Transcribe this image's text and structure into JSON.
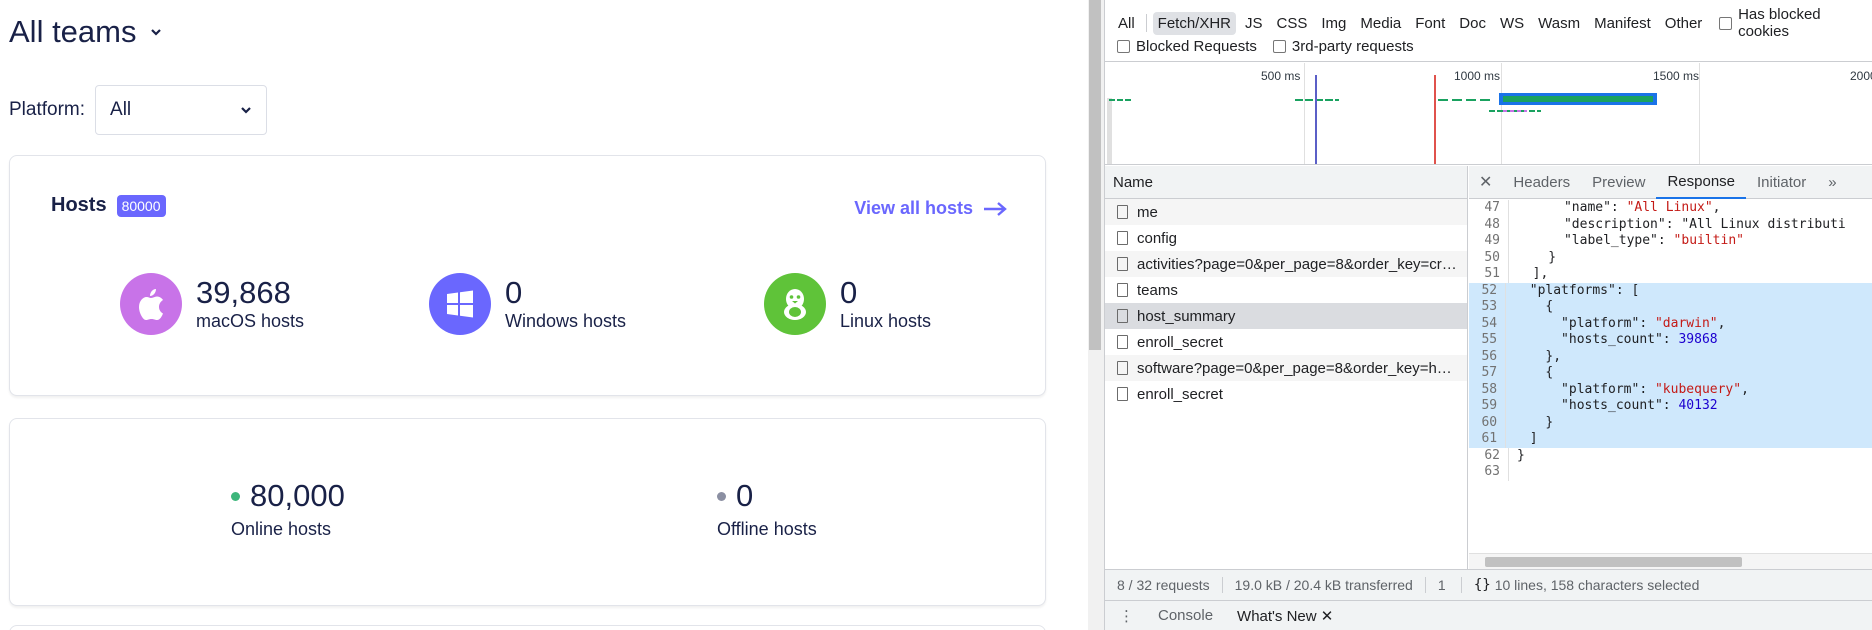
{
  "app": {
    "team_title": "All teams",
    "platform_label": "Platform:",
    "platform_value": "All",
    "hosts_card": {
      "title": "Hosts",
      "badge": "80000",
      "view_all": "View all hosts",
      "platforms": [
        {
          "count": "39,868",
          "label": "macOS hosts",
          "icon": "apple-icon",
          "color": "#c873e8"
        },
        {
          "count": "0",
          "label": "Windows hosts",
          "icon": "windows-icon",
          "color": "#6a67fe"
        },
        {
          "count": "0",
          "label": "Linux hosts",
          "icon": "linux-icon",
          "color": "#5fc339"
        }
      ]
    },
    "status_card": {
      "online_count": "80,000",
      "online_label": "Online hosts",
      "offline_count": "0",
      "offline_label": "Offline hosts",
      "online_color": "#3db67b",
      "offline_color": "#8b8fa2"
    }
  },
  "devtools": {
    "filter_types": [
      "All",
      "Fetch/XHR",
      "JS",
      "CSS",
      "Img",
      "Media",
      "Font",
      "Doc",
      "WS",
      "Wasm",
      "Manifest",
      "Other"
    ],
    "active_filter": "Fetch/XHR",
    "has_blocked_cookies": "Has blocked cookies",
    "blocked_requests": "Blocked Requests",
    "third_party": "3rd-party requests",
    "timeline_ticks": [
      "500 ms",
      "1000 ms",
      "1500 ms",
      "2000"
    ],
    "name_header": "Name",
    "requests": [
      "me",
      "config",
      "activities?page=0&per_page=8&order_key=cr…",
      "teams",
      "host_summary",
      "enroll_secret",
      "software?page=0&per_page=8&order_key=h…",
      "enroll_secret"
    ],
    "selected_request": "host_summary",
    "tabs": [
      "Headers",
      "Preview",
      "Response",
      "Initiator"
    ],
    "active_tab": "Response",
    "code_lines": [
      {
        "n": "47",
        "t": "      \"name\": \"All Linux\","
      },
      {
        "n": "48",
        "t": "      \"description\": \"All Linux distributi"
      },
      {
        "n": "49",
        "t": "      \"label_type\": \"builtin\""
      },
      {
        "n": "50",
        "t": "    }"
      },
      {
        "n": "51",
        "t": "  ],"
      },
      {
        "n": "52",
        "t": "  \"platforms\": ["
      },
      {
        "n": "53",
        "t": "    {"
      },
      {
        "n": "54",
        "t": "      \"platform\": \"darwin\","
      },
      {
        "n": "55",
        "t": "      \"hosts_count\": 39868"
      },
      {
        "n": "56",
        "t": "    },"
      },
      {
        "n": "57",
        "t": "    {"
      },
      {
        "n": "58",
        "t": "      \"platform\": \"kubequery\","
      },
      {
        "n": "59",
        "t": "      \"hosts_count\": 40132"
      },
      {
        "n": "60",
        "t": "    }"
      },
      {
        "n": "61",
        "t": "  ]"
      },
      {
        "n": "62",
        "t": "}"
      },
      {
        "n": "63",
        "t": ""
      }
    ],
    "status_requests": "8 / 32 requests",
    "status_transferred": "19.0 kB / 20.4 kB transferred",
    "status_extra": "1",
    "status_selection": "10 lines, 158 characters selected",
    "drawer_tabs": [
      "Console",
      "What's New"
    ]
  }
}
